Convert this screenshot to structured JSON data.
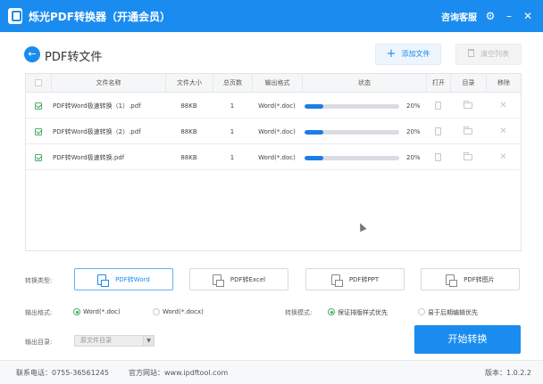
{
  "titlebar": {
    "title": "烁光PDF转换器（开通会员）",
    "support": "咨询客服",
    "icons": [
      "gear-icon",
      "minimize-icon",
      "close-icon"
    ]
  },
  "header": {
    "title": "PDF转文件",
    "add_file": "添加文件",
    "clear_list": "清空列表"
  },
  "table": {
    "columns": [
      "",
      "文件名称",
      "文件大小",
      "总页数",
      "输出格式",
      "状态",
      "打开",
      "目录",
      "移除"
    ],
    "rows": [
      {
        "name": "PDF转Word极速转换（1）.pdf",
        "size": "88KB",
        "pages": "1",
        "format": "Word(*.doc)",
        "progress": 20,
        "pct": "20%",
        "checked": true
      },
      {
        "name": "PDF转Word极速转换（2）.pdf",
        "size": "88KB",
        "pages": "1",
        "format": "Word(*.doc)",
        "progress": 20,
        "pct": "20%",
        "checked": true
      },
      {
        "name": "PDF转Word极速转换.pdf",
        "size": "88KB",
        "pages": "1",
        "format": "Word(*.doc)",
        "progress": 20,
        "pct": "20%",
        "checked": true
      }
    ]
  },
  "options": {
    "type_label": "转换类型:",
    "types": [
      "PDF转Word",
      "PDF转Excel",
      "PDF转PPT",
      "PDF转图片"
    ],
    "selected_type": "PDF转Word",
    "format_label": "输出格式:",
    "formats": [
      "Word(*.doc)",
      "Word(*.docx)"
    ],
    "selected_format": "Word(*.doc)",
    "mode_label": "转换模式:",
    "modes": [
      "保证排版样式优先",
      "易于后期编辑优先"
    ],
    "selected_mode": "保证排版样式优先",
    "dir_label": "输出目录:",
    "dir_value": "原文件目录",
    "start": "开始转换"
  },
  "footer": {
    "phone": "联系电话：0755-36561245",
    "website": "官方网站：www.ipdftool.com",
    "version": "版本：1.0.2.2"
  },
  "colors": {
    "accent": "#1a8cf0",
    "check": "#3aa85a"
  }
}
